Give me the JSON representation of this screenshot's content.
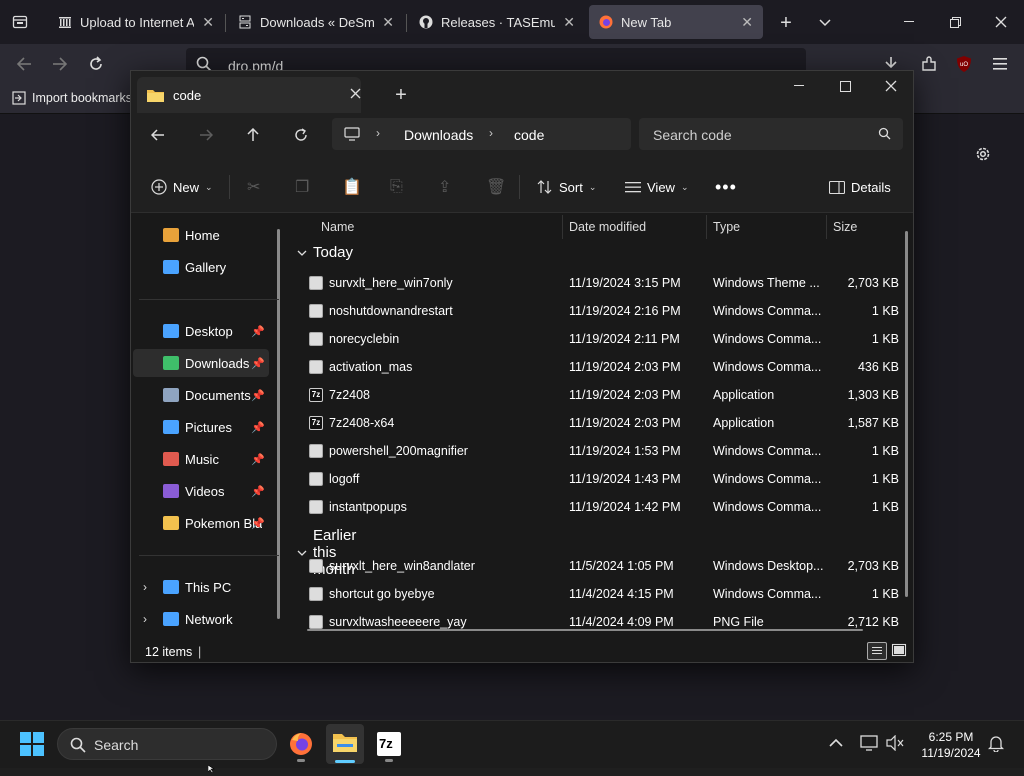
{
  "browser": {
    "tabs": [
      {
        "label": "Upload to Internet Archive",
        "icon": "archive-icon"
      },
      {
        "label": "Downloads « DeSmuME",
        "icon": "desmume-icon"
      },
      {
        "label": "Releases · TASEmulators",
        "icon": "github-icon"
      },
      {
        "label": "New Tab",
        "icon": "firefox-icon",
        "active": true
      }
    ],
    "url": "dro.pm/d",
    "bookmarks_import": "Import bookmarks..."
  },
  "explorer": {
    "title": "code",
    "breadcrumb": [
      "Downloads",
      "code"
    ],
    "search_placeholder": "Search code",
    "commands": {
      "new": "New",
      "sort": "Sort",
      "view": "View",
      "details": "Details"
    },
    "sidebar": [
      {
        "label": "Home",
        "icon": "home-icon",
        "color": "#e8a23a"
      },
      {
        "label": "Gallery",
        "icon": "gallery-icon",
        "color": "#4aa3ff"
      },
      {
        "label": "Desktop",
        "icon": "desktop-icon",
        "color": "#4aa3ff",
        "pinned": true
      },
      {
        "label": "Downloads",
        "icon": "downloads-icon",
        "color": "#3fbf6a",
        "pinned": true,
        "selected": true
      },
      {
        "label": "Documents",
        "icon": "documents-icon",
        "color": "#8fa4c0",
        "pinned": true
      },
      {
        "label": "Pictures",
        "icon": "pictures-icon",
        "color": "#4aa3ff",
        "pinned": true
      },
      {
        "label": "Music",
        "icon": "music-icon",
        "color": "#e05a4f",
        "pinned": true
      },
      {
        "label": "Videos",
        "icon": "videos-icon",
        "color": "#8a5cd6",
        "pinned": true
      },
      {
        "label": "Pokemon Bla",
        "icon": "folder-icon",
        "color": "#f2c14e",
        "pinned": true
      },
      {
        "label": "This PC",
        "icon": "pc-icon",
        "color": "#4aa3ff"
      },
      {
        "label": "Network",
        "icon": "network-icon",
        "color": "#4aa3ff"
      }
    ],
    "columns": {
      "name": "Name",
      "date": "Date modified",
      "type": "Type",
      "size": "Size"
    },
    "groups": [
      {
        "label": "Today",
        "files": [
          {
            "name": "survxlt_here_win7only",
            "date": "11/19/2024 3:15 PM",
            "type": "Windows Theme ...",
            "size": "2,703 KB",
            "icon": "file-icon"
          },
          {
            "name": "noshutdownandrestart",
            "date": "11/19/2024 2:16 PM",
            "type": "Windows Comma...",
            "size": "1 KB",
            "icon": "cmd-file-icon"
          },
          {
            "name": "norecyclebin",
            "date": "11/19/2024 2:11 PM",
            "type": "Windows Comma...",
            "size": "1 KB",
            "icon": "cmd-file-icon"
          },
          {
            "name": "activation_mas",
            "date": "11/19/2024 2:03 PM",
            "type": "Windows Comma...",
            "size": "436 KB",
            "icon": "cmd-file-icon"
          },
          {
            "name": "7z2408",
            "date": "11/19/2024 2:03 PM",
            "type": "Application",
            "size": "1,303 KB",
            "icon": "7z-app-icon"
          },
          {
            "name": "7z2408-x64",
            "date": "11/19/2024 2:03 PM",
            "type": "Application",
            "size": "1,587 KB",
            "icon": "7z-app-icon"
          },
          {
            "name": "powershell_200magnifier",
            "date": "11/19/2024 1:53 PM",
            "type": "Windows Comma...",
            "size": "1 KB",
            "icon": "cmd-file-icon"
          },
          {
            "name": "logoff",
            "date": "11/19/2024 1:43 PM",
            "type": "Windows Comma...",
            "size": "1 KB",
            "icon": "cmd-file-icon"
          },
          {
            "name": "instantpopups",
            "date": "11/19/2024 1:42 PM",
            "type": "Windows Comma...",
            "size": "1 KB",
            "icon": "cmd-file-icon"
          }
        ]
      },
      {
        "label": "Earlier this month",
        "files": [
          {
            "name": "survxlt_here_win8andlater",
            "date": "11/5/2024 1:05 PM",
            "type": "Windows Desktop...",
            "size": "2,703 KB",
            "icon": "file-icon"
          },
          {
            "name": "shortcut go byebye",
            "date": "11/4/2024 4:15 PM",
            "type": "Windows Comma...",
            "size": "1 KB",
            "icon": "cmd-file-icon"
          },
          {
            "name": "survxltwasheeeeere_yay",
            "date": "11/4/2024 4:09 PM",
            "type": "PNG File",
            "size": "2,712 KB",
            "icon": "png-file-icon"
          }
        ]
      }
    ],
    "status": "12 items"
  },
  "taskbar": {
    "search": "Search",
    "time": "6:25 PM",
    "date": "11/19/2024"
  }
}
